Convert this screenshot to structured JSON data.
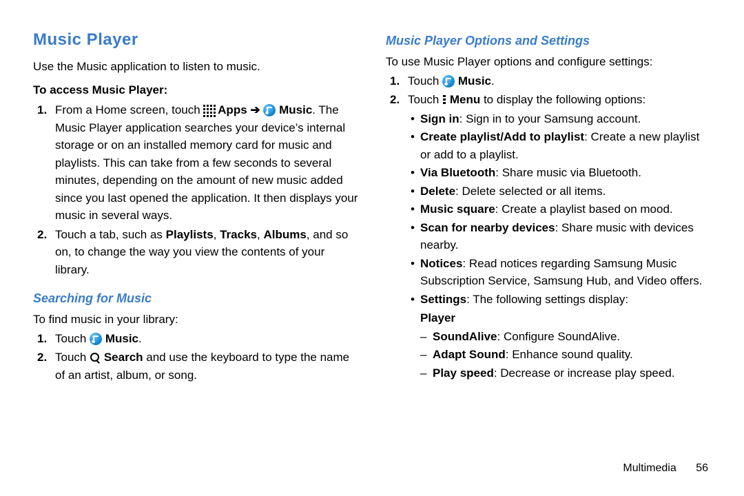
{
  "left": {
    "h1": "Music Player",
    "intro": "Use the Music application to listen to music.",
    "access_label": "To access Music Player:",
    "step1_pre": "From a Home screen, touch ",
    "step1_apps": "Apps",
    "step1_arrow": " ➔ ",
    "step1_music": "Music",
    "step1_post": ". The Music Player application searches your device’s internal storage or on an installed memory card for music and playlists. This can take from a few seconds to several minutes, depending on the amount of new music added since you last opened the application. It then displays your music in several ways.",
    "step2_pre": "Touch a tab, such as ",
    "step2_b1": "Playlists",
    "step2_sep1": ", ",
    "step2_b2": "Tracks",
    "step2_sep2": ", ",
    "step2_b3": "Albums",
    "step2_post": ", and so on, to change the way you view the contents of your library.",
    "h2_search": "Searching for Music",
    "search_intro": "To find music in your library:",
    "search1_pre": "Touch ",
    "search1_b": "Music",
    "search1_post": ".",
    "search2_pre": "Touch ",
    "search2_b": "Search",
    "search2_post": " and use the keyboard to type the name of an artist, album, or song."
  },
  "right": {
    "h2_options": "Music Player Options and Settings",
    "options_intro": "To use Music Player options and configure settings:",
    "opt1_pre": "Touch ",
    "opt1_b": "Music",
    "opt1_post": ".",
    "opt2_pre": "Touch ",
    "opt2_b": "Menu",
    "opt2_post": " to display the following options:",
    "bul_signin_b": "Sign in",
    "bul_signin_t": ": Sign in to your Samsung account.",
    "bul_create_b": "Create playlist/Add to playlist",
    "bul_create_t": ": Create a new playlist or add to a playlist.",
    "bul_bt_b": "Via Bluetooth",
    "bul_bt_t": ": Share music via Bluetooth.",
    "bul_del_b": "Delete",
    "bul_del_t": ": Delete selected or all items.",
    "bul_sq_b": "Music square",
    "bul_sq_t": ": Create a playlist based on mood.",
    "bul_scan_b": "Scan for nearby devices",
    "bul_scan_t": ": Share music with devices nearby.",
    "bul_not_b": "Notices",
    "bul_not_t": ": Read notices regarding Samsung Music Subscription Service, Samsung Hub, and Video offers.",
    "bul_set_b": "Settings",
    "bul_set_t": ": The following settings display:",
    "player_label": "Player",
    "d_sa_b": "SoundAlive",
    "d_sa_t": ": Configure SoundAlive.",
    "d_as_b": "Adapt Sound",
    "d_as_t": ": Enhance sound quality.",
    "d_ps_b": "Play speed",
    "d_ps_t": ": Decrease or increase play speed."
  },
  "footer": {
    "section": "Multimedia",
    "page": "56"
  }
}
